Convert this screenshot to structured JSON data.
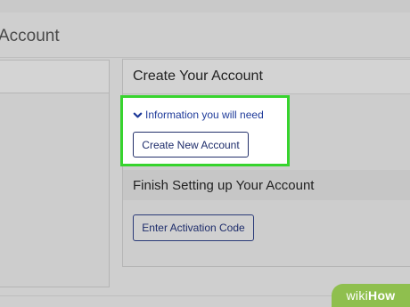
{
  "page": {
    "title": "Account"
  },
  "right_panel": {
    "header": "Create Your Account",
    "info_link": "Information you will need",
    "create_button": "Create New Account",
    "finish_header": "Finish Setting up Your Account",
    "activation_button": "Enter Activation Code"
  },
  "watermark": {
    "prefix": "wiki",
    "suffix": "How"
  },
  "colors": {
    "highlight_border": "#37d42e",
    "link": "#1f3b9a",
    "watermark_bg": "#8fbf4e"
  }
}
